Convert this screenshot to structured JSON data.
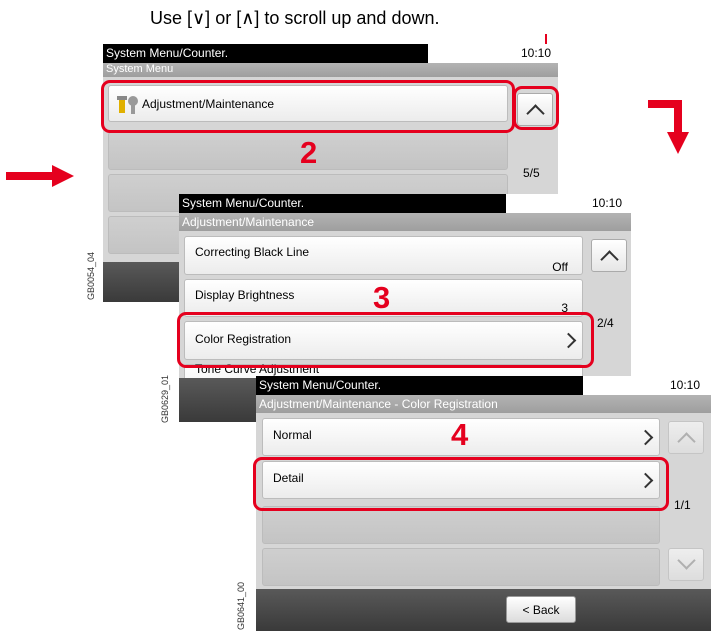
{
  "caption": "Use [∨] or [∧] to scroll up and down.",
  "colors": {
    "accent_red": "#e5001e",
    "screen_bg": "#d6d6d6",
    "footer": "#4a4a4a"
  },
  "screen1": {
    "title": "System Menu/Counter.",
    "time": "10:10",
    "subtitle": "System Menu",
    "item_label": "Adjustment/Maintenance",
    "item_icon": "wrench-icon",
    "page": "5/5",
    "step": "2",
    "code": "GB0054_04"
  },
  "screen2": {
    "title": "System Menu/Counter.",
    "time": "10:10",
    "subtitle": "Adjustment/Maintenance",
    "items": [
      {
        "label": "Correcting Black Line",
        "value": "Off"
      },
      {
        "label": "Display Brightness",
        "value": "3"
      },
      {
        "label": "Color Registration",
        "value": ""
      },
      {
        "label": "Tone Curve Adjustment",
        "value": ""
      }
    ],
    "page": "2/4",
    "step": "3",
    "code": "GB0629_01"
  },
  "screen3": {
    "title": "System Menu/Counter.",
    "time": "10:10",
    "subtitle": "Adjustment/Maintenance - Color Registration",
    "items": [
      {
        "label": "Normal"
      },
      {
        "label": "Detail"
      }
    ],
    "page": "1/1",
    "step": "4",
    "back_label": "< Back",
    "code": "GB0641_00"
  }
}
